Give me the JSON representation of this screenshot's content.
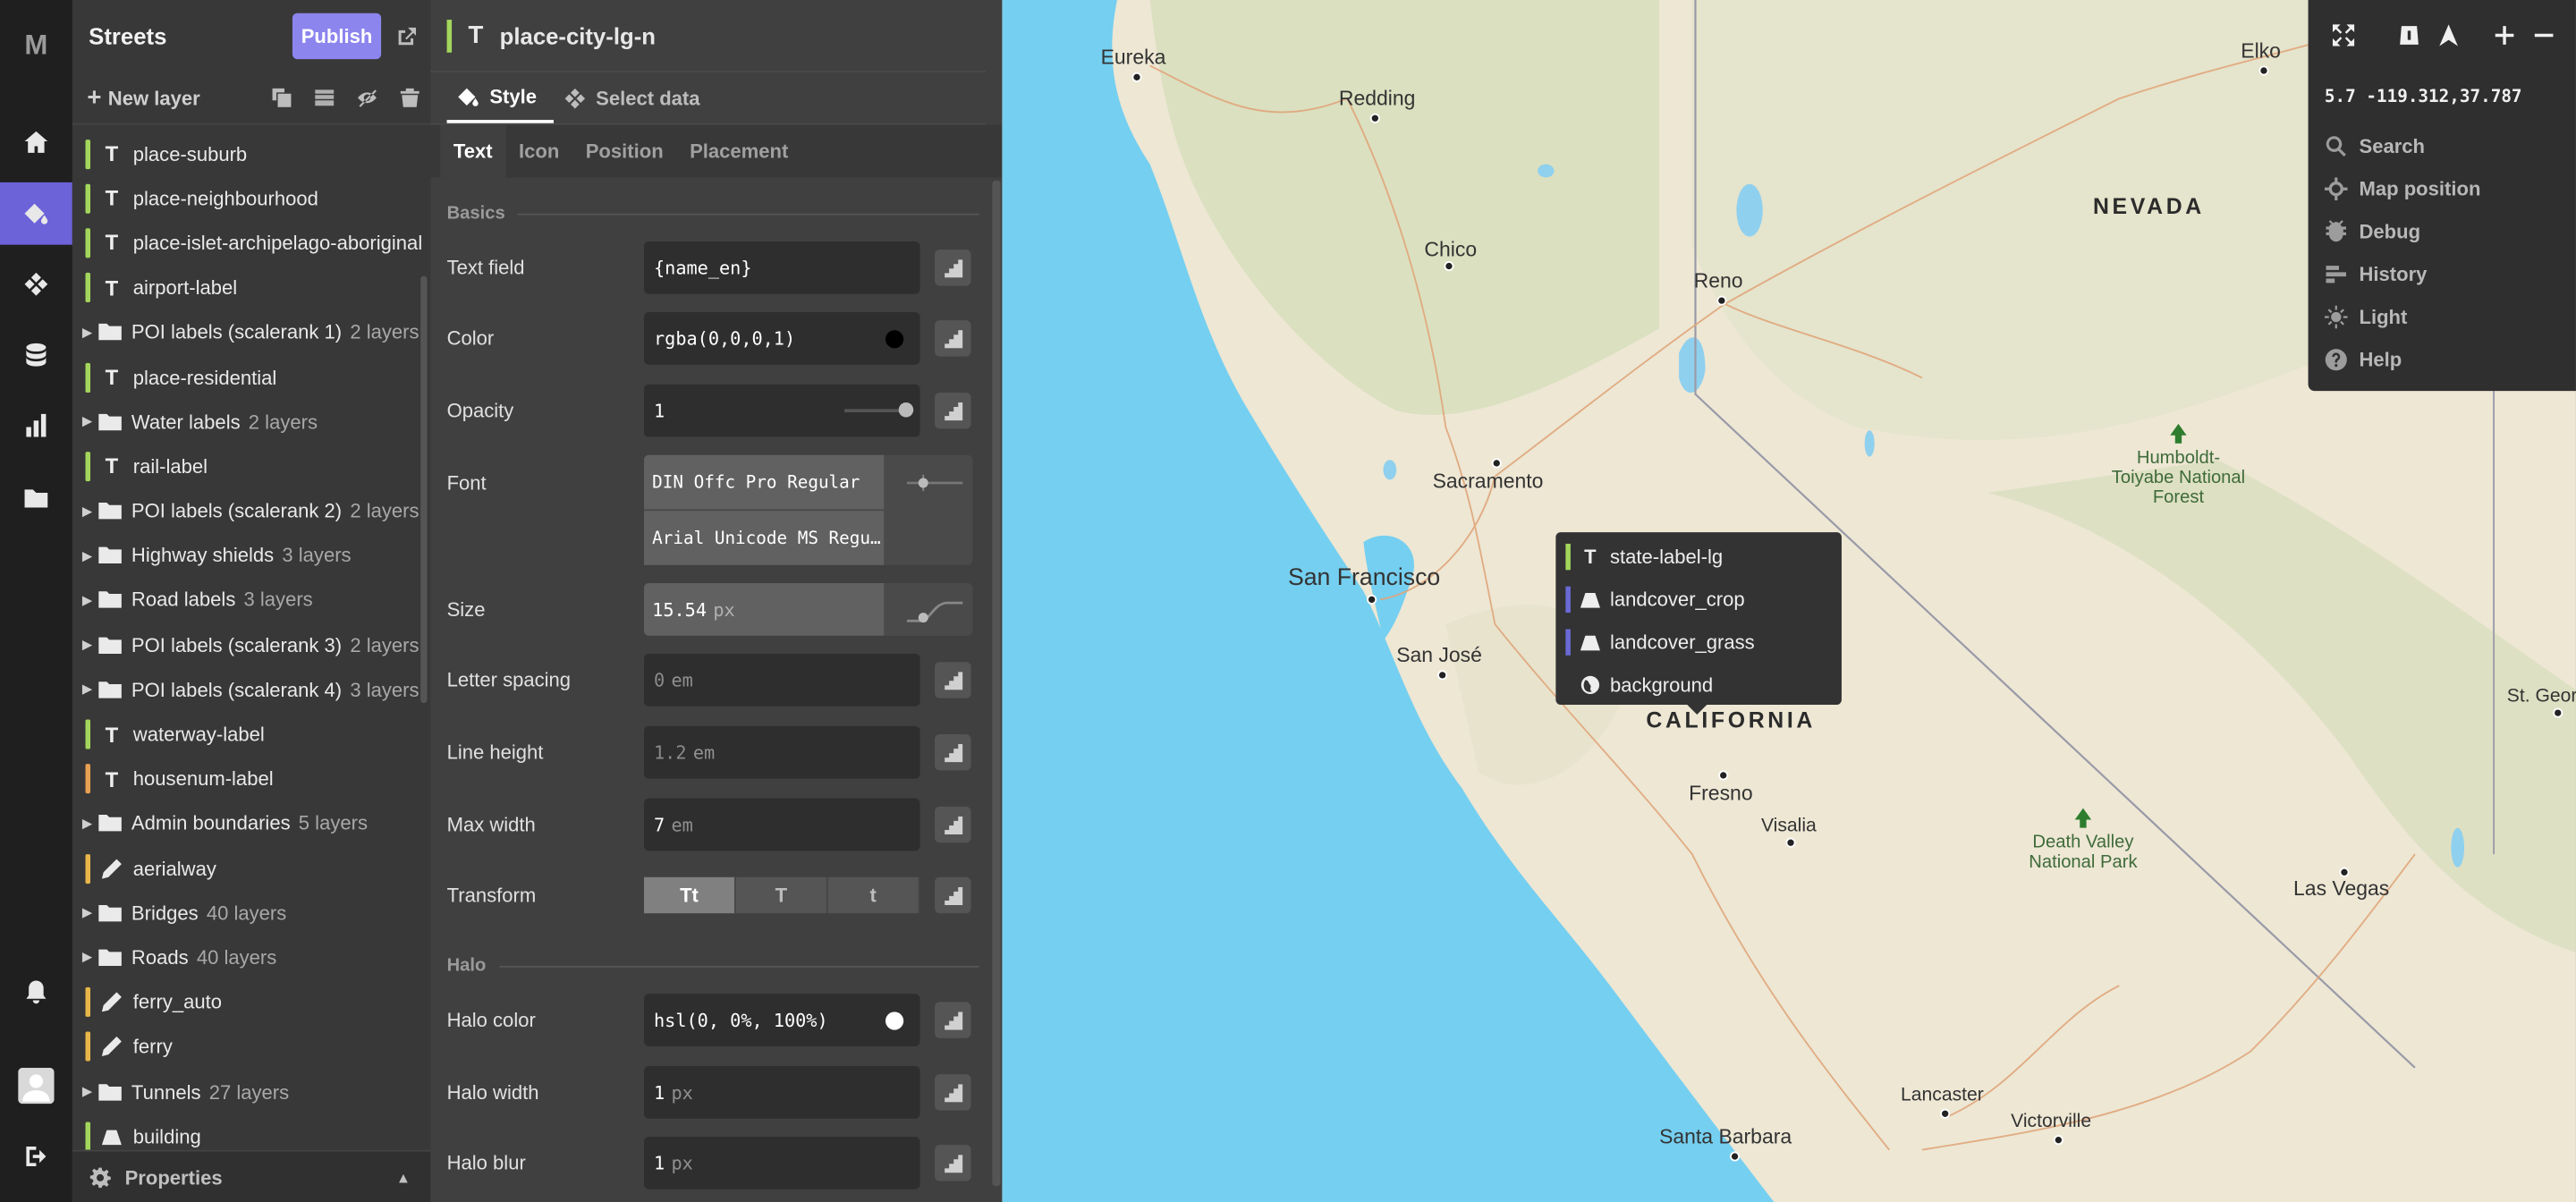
{
  "app": {
    "logo": "M"
  },
  "panel": {
    "title": "Streets",
    "publish_label": "Publish",
    "new_layer_label": "New layer",
    "properties_label": "Properties"
  },
  "layers": [
    {
      "name": "place-suburb",
      "type": "text",
      "color": "#a3d65c"
    },
    {
      "name": "place-neighbourhood",
      "type": "text",
      "color": "#a3d65c"
    },
    {
      "name": "place-islet-archipelago-aboriginal",
      "type": "text",
      "color": "#a3d65c"
    },
    {
      "name": "airport-label",
      "type": "text",
      "color": "#a3d65c"
    },
    {
      "name": "POI labels (scalerank 1)",
      "type": "group",
      "count": "2 layers"
    },
    {
      "name": "place-residential",
      "type": "text",
      "color": "#a3d65c"
    },
    {
      "name": "Water labels",
      "type": "group",
      "count": "2 layers"
    },
    {
      "name": "rail-label",
      "type": "text",
      "color": "#a3d65c"
    },
    {
      "name": "POI labels (scalerank 2)",
      "type": "group",
      "count": "2 layers"
    },
    {
      "name": "Highway shields",
      "type": "group",
      "count": "3 layers"
    },
    {
      "name": "Road labels",
      "type": "group",
      "count": "3 layers"
    },
    {
      "name": "POI labels (scalerank 3)",
      "type": "group",
      "count": "2 layers"
    },
    {
      "name": "POI labels (scalerank 4)",
      "type": "group",
      "count": "3 layers"
    },
    {
      "name": "waterway-label",
      "type": "text",
      "color": "#a3d65c"
    },
    {
      "name": "housenum-label",
      "type": "text",
      "color": "#e8a052"
    },
    {
      "name": "Admin boundaries",
      "type": "group",
      "count": "5 layers"
    },
    {
      "name": "aerialway",
      "type": "line",
      "color": "#e8b64a"
    },
    {
      "name": "Bridges",
      "type": "group",
      "count": "40 layers"
    },
    {
      "name": "Roads",
      "type": "group",
      "count": "40 layers"
    },
    {
      "name": "ferry_auto",
      "type": "line",
      "color": "#e8b64a"
    },
    {
      "name": "ferry",
      "type": "line",
      "color": "#e8b64a"
    },
    {
      "name": "Tunnels",
      "type": "group",
      "count": "27 layers"
    },
    {
      "name": "building",
      "type": "fill",
      "color": "#a3d65c"
    }
  ],
  "editor": {
    "layer_name": "place-city-lg-n",
    "tabs": [
      "Style",
      "Select data"
    ],
    "subtabs": [
      "Text",
      "Icon",
      "Position",
      "Placement"
    ],
    "sections": {
      "basics": "Basics",
      "halo": "Halo"
    },
    "props": {
      "text_field": {
        "label": "Text field",
        "value": "{name_en}"
      },
      "color": {
        "label": "Color",
        "value": "rgba(0,0,0,1)",
        "swatch": "#000000"
      },
      "opacity": {
        "label": "Opacity",
        "value": "1",
        "level": 1.0
      },
      "font": {
        "label": "Font",
        "value1": "DIN Offc Pro Regular",
        "value2": "Arial Unicode MS Regu…"
      },
      "size": {
        "label": "Size",
        "value": "15.54",
        "unit": "px"
      },
      "letter_spacing": {
        "label": "Letter spacing",
        "value": "0",
        "unit": "em"
      },
      "line_height": {
        "label": "Line height",
        "value": "1.2",
        "unit": "em"
      },
      "max_width": {
        "label": "Max width",
        "value": "7",
        "unit": "em"
      },
      "transform": {
        "label": "Transform",
        "options": [
          "Tt",
          "T",
          "t"
        ],
        "selected": "Tt"
      },
      "halo_color": {
        "label": "Halo color",
        "value": "hsl(0, 0%, 100%)",
        "swatch": "#ffffff"
      },
      "halo_width": {
        "label": "Halo width",
        "value": "1",
        "unit": "px"
      },
      "halo_blur": {
        "label": "Halo blur",
        "value": "1",
        "unit": "px"
      }
    }
  },
  "map": {
    "cities": {
      "eureka": "Eureka",
      "redding": "Redding",
      "chico": "Chico",
      "reno": "Reno",
      "sacramento": "Sacramento",
      "san_francisco": "San Francisco",
      "san_jose": "San José",
      "fresno": "Fresno",
      "visalia": "Visalia",
      "elko": "Elko",
      "las_vegas": "Las Vegas",
      "lancaster": "Lancaster",
      "victorville": "Victorville",
      "santa_barbara": "Santa Barbara",
      "st_george": "St. Geor"
    },
    "states": {
      "nevada": "NEVADA",
      "california": "CALIFORNIA"
    },
    "parks": {
      "humboldt": [
        "Humboldt-",
        "Toiyabe National",
        "Forest"
      ],
      "death_valley": [
        "Death Valley",
        "National Park"
      ]
    },
    "popup": [
      {
        "name": "state-label-lg",
        "type": "text",
        "color": "#a3d65c"
      },
      {
        "name": "landcover_crop",
        "type": "fill",
        "color": "#6a6ad6"
      },
      {
        "name": "landcover_grass",
        "type": "fill",
        "color": "#6a6ad6"
      },
      {
        "name": "background",
        "type": "background",
        "color": ""
      }
    ],
    "controls": {
      "coords": "5.7 -119.312,37.787",
      "items": [
        "Search",
        "Map position",
        "Debug",
        "History",
        "Light",
        "Help"
      ]
    }
  }
}
